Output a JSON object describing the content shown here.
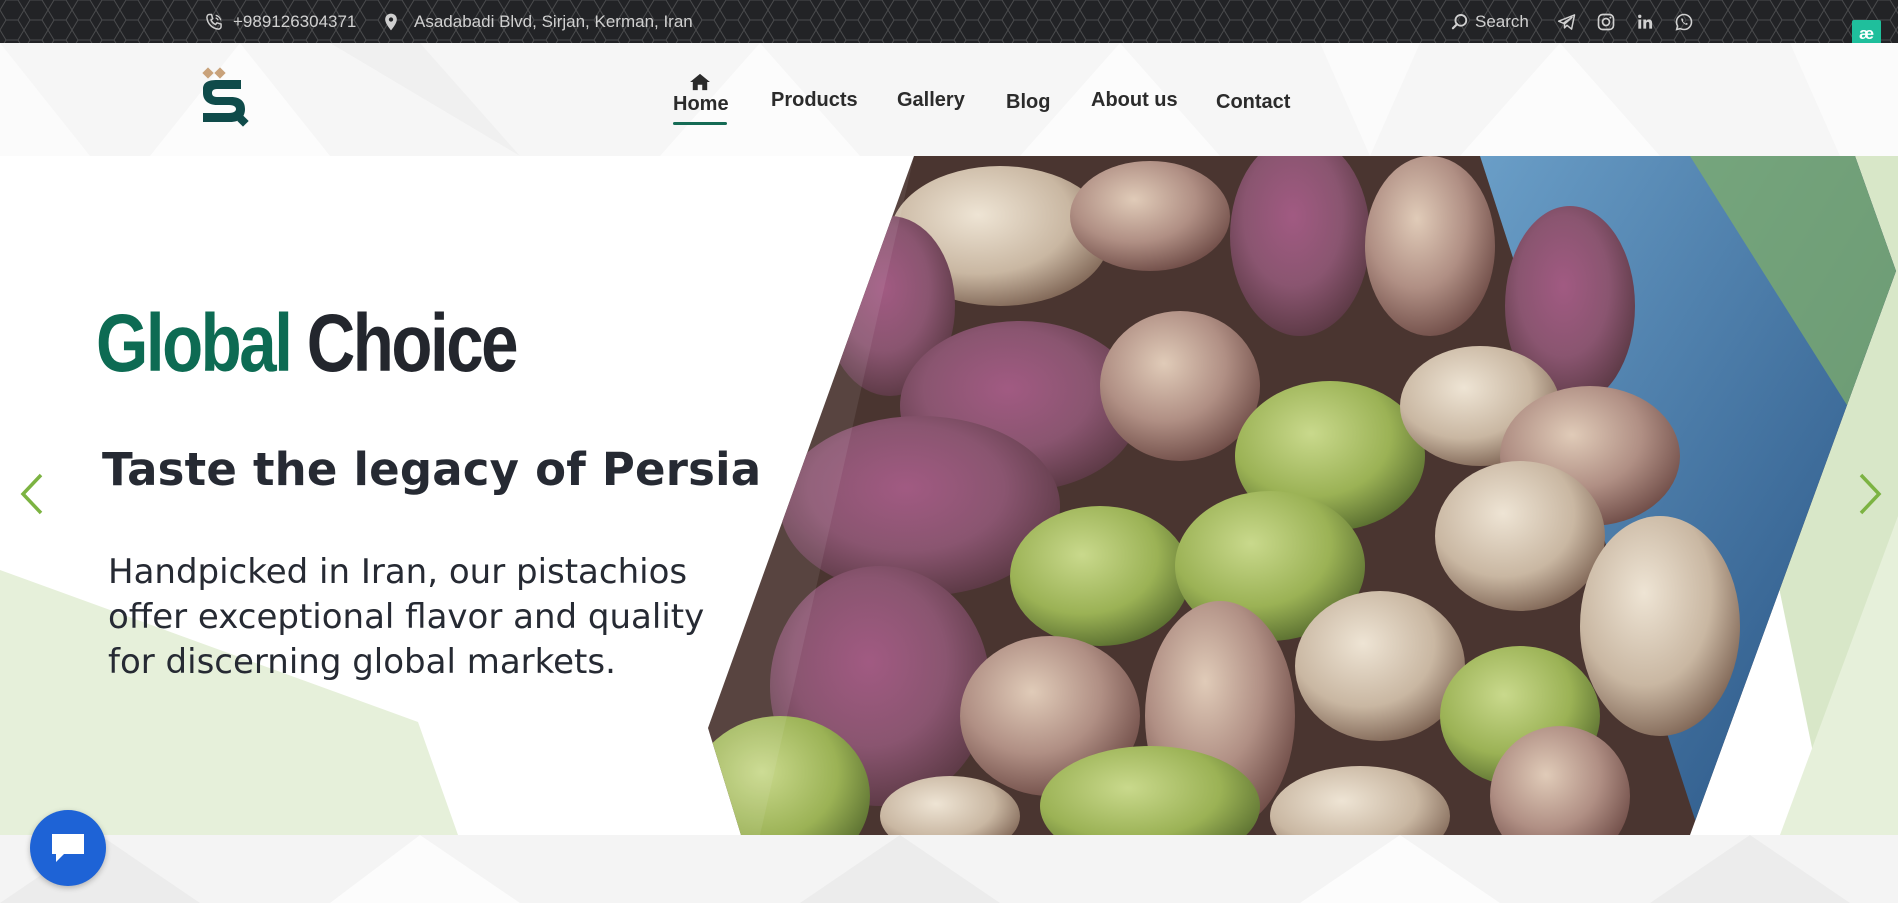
{
  "topbar": {
    "phone": "+989126304371",
    "address": "Asadabadi Blvd, Sirjan, Kerman, Iran",
    "search_label": "Search",
    "social_icons": [
      "telegram-icon",
      "instagram-icon",
      "linkedin-icon",
      "whatsapp-icon"
    ],
    "badge": "æ"
  },
  "nav": {
    "items": [
      {
        "label": "Home",
        "active": true
      },
      {
        "label": "Products"
      },
      {
        "label": "Gallery"
      },
      {
        "label": "Blog"
      },
      {
        "label": "About us"
      },
      {
        "label": "Contact"
      }
    ]
  },
  "hero": {
    "headline_part1": "Global",
    "headline_part2": "Choice",
    "subheading": "Taste the legacy of Persia",
    "description": "Handpicked in Iran, our pistachios offer exceptional flavor and quality for discerning global markets.",
    "image_subject": "pistachio kernels"
  },
  "colors": {
    "brand_green": "#0d6b53",
    "accent_light_green": "#e6f0da",
    "arrow_green": "#7cb342",
    "chat_blue": "#1e63d6",
    "topbar_bg": "#222326"
  }
}
